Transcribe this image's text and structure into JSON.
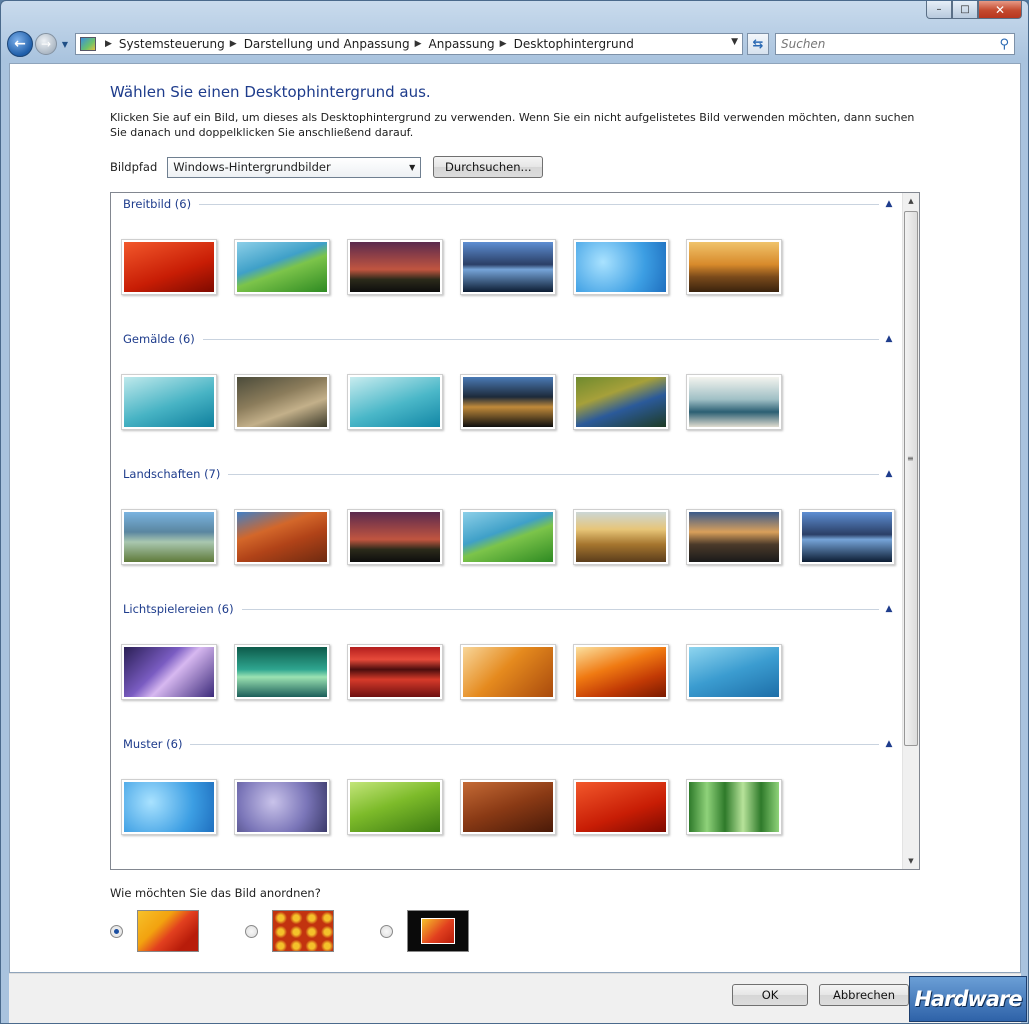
{
  "window": {
    "caption": {
      "minimize": "–",
      "maximize": "□",
      "close": "✕"
    }
  },
  "navbar": {
    "back_icon": "arrow-left-icon",
    "forward_icon": "arrow-right-icon",
    "breadcrumbs": [
      "Systemsteuerung",
      "Darstellung und Anpassung",
      "Anpassung",
      "Desktophintergrund"
    ],
    "search_placeholder": "Suchen"
  },
  "main": {
    "title": "Wählen Sie einen Desktophintergrund aus.",
    "description": "Klicken Sie auf ein Bild, um dieses als Desktophintergrund zu verwenden. Wenn Sie ein nicht aufgelistetes Bild verwenden möchten, dann suchen Sie danach und doppelklicken Sie anschließend darauf.",
    "path_label": "Bildpfad",
    "path_value": "Windows-Hintergrundbilder",
    "browse_label": "Durchsuchen...",
    "groups": [
      {
        "name": "Breitbild (6)",
        "thumbs": [
          "linear-gradient(160deg,#f2582b,#c81d05 60%,#7e0a00)",
          "linear-gradient(160deg,#8ccfe8,#3fa0c8 40%,#7cc44a 55%,#2e8a22)",
          "linear-gradient(180deg,#5b2a4e,#c15540 55%,#2b2a1a 75%,#0d0d0d)",
          "linear-gradient(180deg,#5d8ed3,#2b3f66 45%,#76a4d8 55%,#0d1d33)",
          "radial-gradient(circle at 30% 40%,#a9e2ff,#3c9ee3 60%,#1f6fbf)",
          "linear-gradient(180deg,#f0c36b,#d88a2b 45%,#7a4a1b 70%,#3a220d)"
        ]
      },
      {
        "name": "Gemälde (6)",
        "thumbs": [
          "linear-gradient(160deg,#bfe9ec,#47b3c4 55%,#0f7f9d)",
          "linear-gradient(160deg,#4b4b3a,#8b7c5b 40%,#c3b08a 65%,#3b3a2a)",
          "linear-gradient(160deg,#c8ecef,#4ab7c8 55%,#1286a5)",
          "linear-gradient(180deg,#4a7ab5,#1d2a3a 40%,#c08a3a 60%,#0f0f0f)",
          "linear-gradient(160deg,#6e8a2e,#a6a03a 35%,#2b5a9a 60%,#1e3b24)",
          "linear-gradient(180deg,#f3f3ee,#9fbfc5 45%,#2b5f73 70%,#e0dcd0)"
        ]
      },
      {
        "name": "Landschaften (7)",
        "thumbs": [
          "linear-gradient(180deg,#7ab3e0,#5a86a0 40%,#a9c7b0 60%,#5f7a3a)",
          "linear-gradient(160deg,#3f7fc6,#d3672a 35%,#b14318 60%,#6e2a10)",
          "linear-gradient(180deg,#5b2a4e,#c15540 55%,#2b2a1a 75%,#0d0d0d)",
          "linear-gradient(160deg,#8ccfe8,#3fa0c8 40%,#7cc44a 55%,#2e8a22)",
          "linear-gradient(180deg,#cbd7d6,#e7c578 35%,#a5752e 65%,#5b3d1c)",
          "linear-gradient(180deg,#3a5a8a,#d9a05b 40%,#4b3a2a 65%,#1a1a1a)",
          "linear-gradient(180deg,#5d8ed3,#2b3f66 45%,#76a4d8 55%,#0d1d33)"
        ]
      },
      {
        "name": "Lichtspielereien (6)",
        "thumbs": [
          "linear-gradient(135deg,#2a1f55,#7a5cc2 40%,#d7b8f0 55%,#3b2a7a)",
          "linear-gradient(180deg,#0d5a4a,#2fa690 45%,#9be2b2 60%,#1b5e5a)",
          "linear-gradient(180deg,#b31e1e,#e64a3a 25%,#4a0d0d 45%,#d63a2a 65%,#6e1010)",
          "linear-gradient(135deg,#f8d69a,#e58a1e 45%,#a94a0d)",
          "linear-gradient(160deg,#fbe1a0,#f07a12 40%,#c23a05 70%,#7a1a00)",
          "linear-gradient(160deg,#8fd5ef,#3b9cd0 50%,#1d6ea8)"
        ]
      },
      {
        "name": "Muster (6)",
        "thumbs": [
          "radial-gradient(circle at 30% 40%,#a9e2ff,#3c9ee3 60%,#1f6fbf)",
          "radial-gradient(circle at 40% 40%,#c9c3ea,#7a75b8 55%,#3b3a6a)",
          "linear-gradient(160deg,#c3e57a,#7dbb2a 45%,#3c7a12)",
          "linear-gradient(160deg,#c46a35,#8a3a15 50%,#4a1a08)",
          "linear-gradient(160deg,#f2582b,#c81d05 60%,#7e0a00)",
          "linear-gradient(90deg,#2e7a2a,#8fd27a 20%,#2e7a2a 40%,#b7e39a 60%,#2e7a2a 80%,#8fd27a)"
        ]
      }
    ],
    "arrange_label": "Wie möchten Sie das Bild anordnen?",
    "arrange_options": [
      {
        "name": "fill",
        "checked": true
      },
      {
        "name": "tile",
        "checked": false
      },
      {
        "name": "center",
        "checked": false
      }
    ]
  },
  "footer": {
    "ok_label": "OK",
    "cancel_label": "Abbrechen",
    "watermark": "Hardware"
  }
}
